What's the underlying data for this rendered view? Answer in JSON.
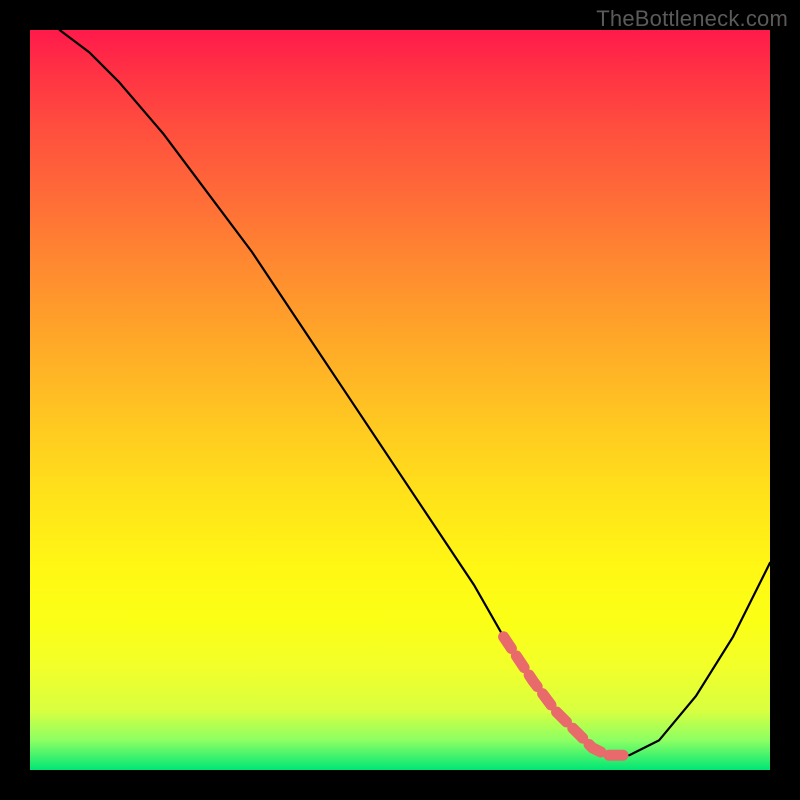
{
  "watermark": "TheBottleneck.com",
  "chart_data": {
    "type": "line",
    "title": "",
    "xlabel": "",
    "ylabel": "",
    "xlim": [
      0,
      100
    ],
    "ylim": [
      0,
      100
    ],
    "grid": false,
    "legend": false,
    "series": [
      {
        "name": "bottleneck-curve",
        "x": [
          4,
          8,
          12,
          18,
          24,
          30,
          36,
          42,
          48,
          54,
          60,
          64,
          68,
          71,
          74,
          76,
          78,
          81,
          85,
          90,
          95,
          100
        ],
        "y": [
          100,
          97,
          93,
          86,
          78,
          70,
          61,
          52,
          43,
          34,
          25,
          18,
          12,
          8,
          5,
          3,
          2,
          2,
          4,
          10,
          18,
          28
        ]
      }
    ],
    "marker_region": {
      "x_start": 64,
      "x_end": 83,
      "color": "#e86a6a",
      "note": "optimal zone indicator along valley"
    },
    "background_gradient": {
      "top": "#ff1a4b",
      "middle": "#ffe21a",
      "bottom": "#00e676"
    }
  }
}
